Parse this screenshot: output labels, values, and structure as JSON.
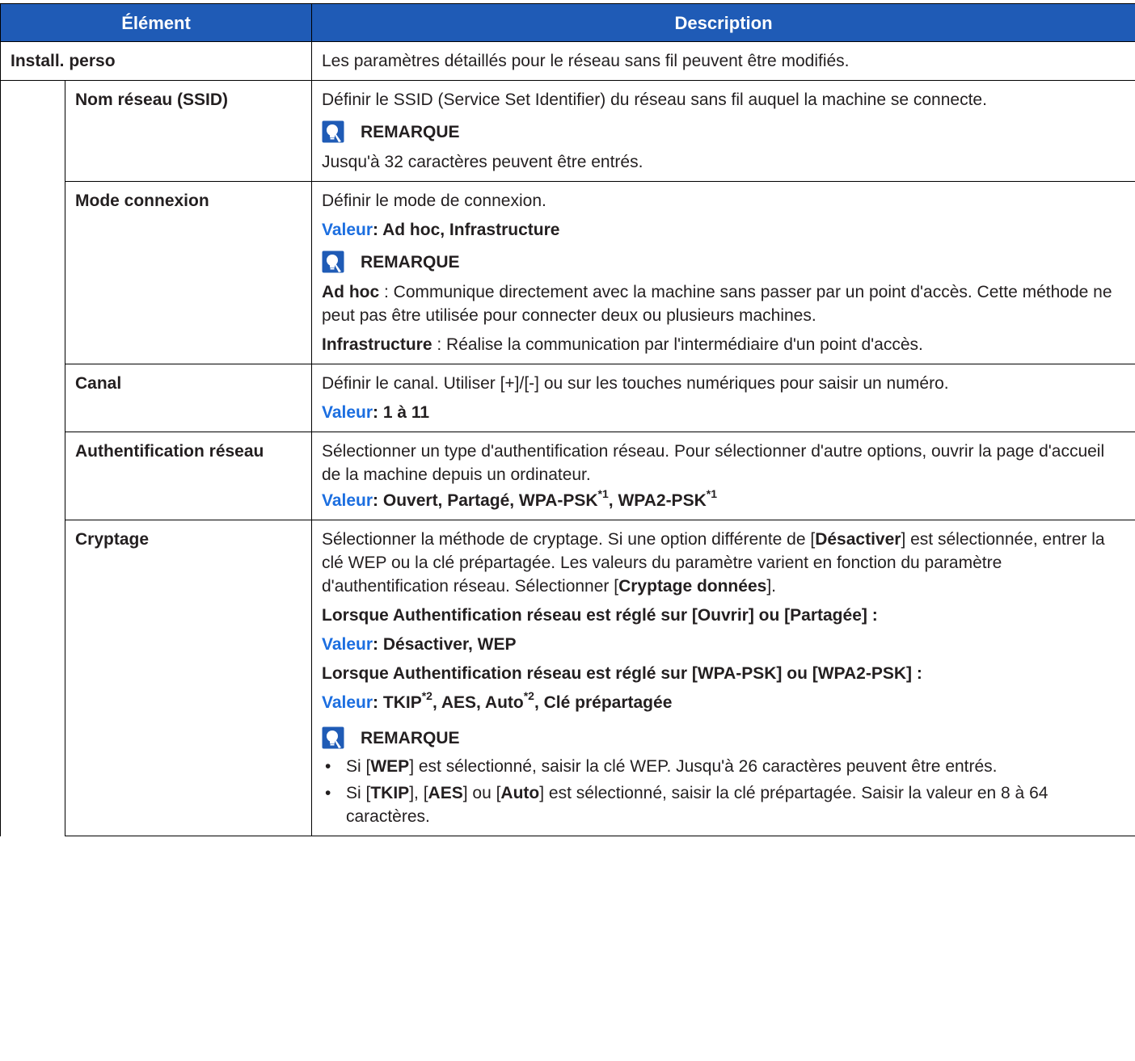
{
  "header": {
    "col1": "Élément",
    "col2": "Description"
  },
  "group": {
    "label": "Install. perso",
    "description": "Les paramètres détaillés pour le réseau sans fil peuvent être modifiés."
  },
  "note_label": "REMARQUE",
  "value_label": "Valeur",
  "rows": {
    "ssid": {
      "label": "Nom réseau (SSID)",
      "description": "Définir le SSID (Service Set Identifier) du réseau sans fil auquel la machine se connecte.",
      "note": "Jusqu'à 32 caractères peuvent être entrés."
    },
    "mode": {
      "label": "Mode connexion",
      "description": "Définir le mode de connexion.",
      "value": ": Ad hoc, Infrastructure",
      "adhoc_term": "Ad hoc",
      "adhoc_text": " : Communique directement avec la machine sans passer par un point d'accès. Cette méthode ne peut pas être utilisée pour connecter deux ou plusieurs machines.",
      "infra_term": "Infrastructure",
      "infra_text": " : Réalise la communication par l'intermédiaire d'un point d'accès."
    },
    "canal": {
      "label": "Canal",
      "description": "Définir le canal. Utiliser [+]/[-] ou sur les touches numériques pour saisir un numéro.",
      "value": ": 1 à 11"
    },
    "auth": {
      "label": "Authentification réseau",
      "description": "Sélectionner un type d'authentification réseau. Pour sélectionner d'autre options, ouvrir la page d'accueil de la machine depuis un ordinateur.",
      "value_part1": ": Ouvert, Partagé, WPA-PSK",
      "sup1": "*1",
      "value_part2": ", WPA2-PSK",
      "sup2": "*1"
    },
    "crypt": {
      "label": "Cryptage",
      "desc_1": "Sélectionner la méthode de cryptage. Si une option différente de [",
      "desc_b1": "Désactiver",
      "desc_2": "] est sélectionnée, entrer la clé WEP ou la clé prépartagée. Les valeurs du paramètre varient en fonction du paramètre d'authentification réseau. Sélectionner [",
      "desc_b2": "Cryptage données",
      "desc_3": "].",
      "cond1": "Lorsque Authentification réseau est réglé sur [Ouvrir] ou [Partagée] :",
      "cond1_value": ": Désactiver, WEP",
      "cond2": "Lorsque Authentification réseau est réglé sur [WPA-PSK] ou [WPA2-PSK] :",
      "cond2_value_a": ": TKIP",
      "cond2_sup_a": "*2",
      "cond2_value_b": ", AES, Auto",
      "cond2_sup_b": "*2",
      "cond2_value_c": ", Clé prépartagée",
      "bullet": "•",
      "b1_a": "Si [",
      "b1_b": "WEP",
      "b1_c": "] est sélectionné, saisir la clé WEP. Jusqu'à 26 caractères peuvent être entrés.",
      "b2_a": "Si [",
      "b2_b": "TKIP",
      "b2_c": "], [",
      "b2_d": "AES",
      "b2_e": "] ou [",
      "b2_f": "Auto",
      "b2_g": "] est sélectionné, saisir la clé prépartagée. Saisir la valeur en 8 à 64 caractères."
    }
  }
}
